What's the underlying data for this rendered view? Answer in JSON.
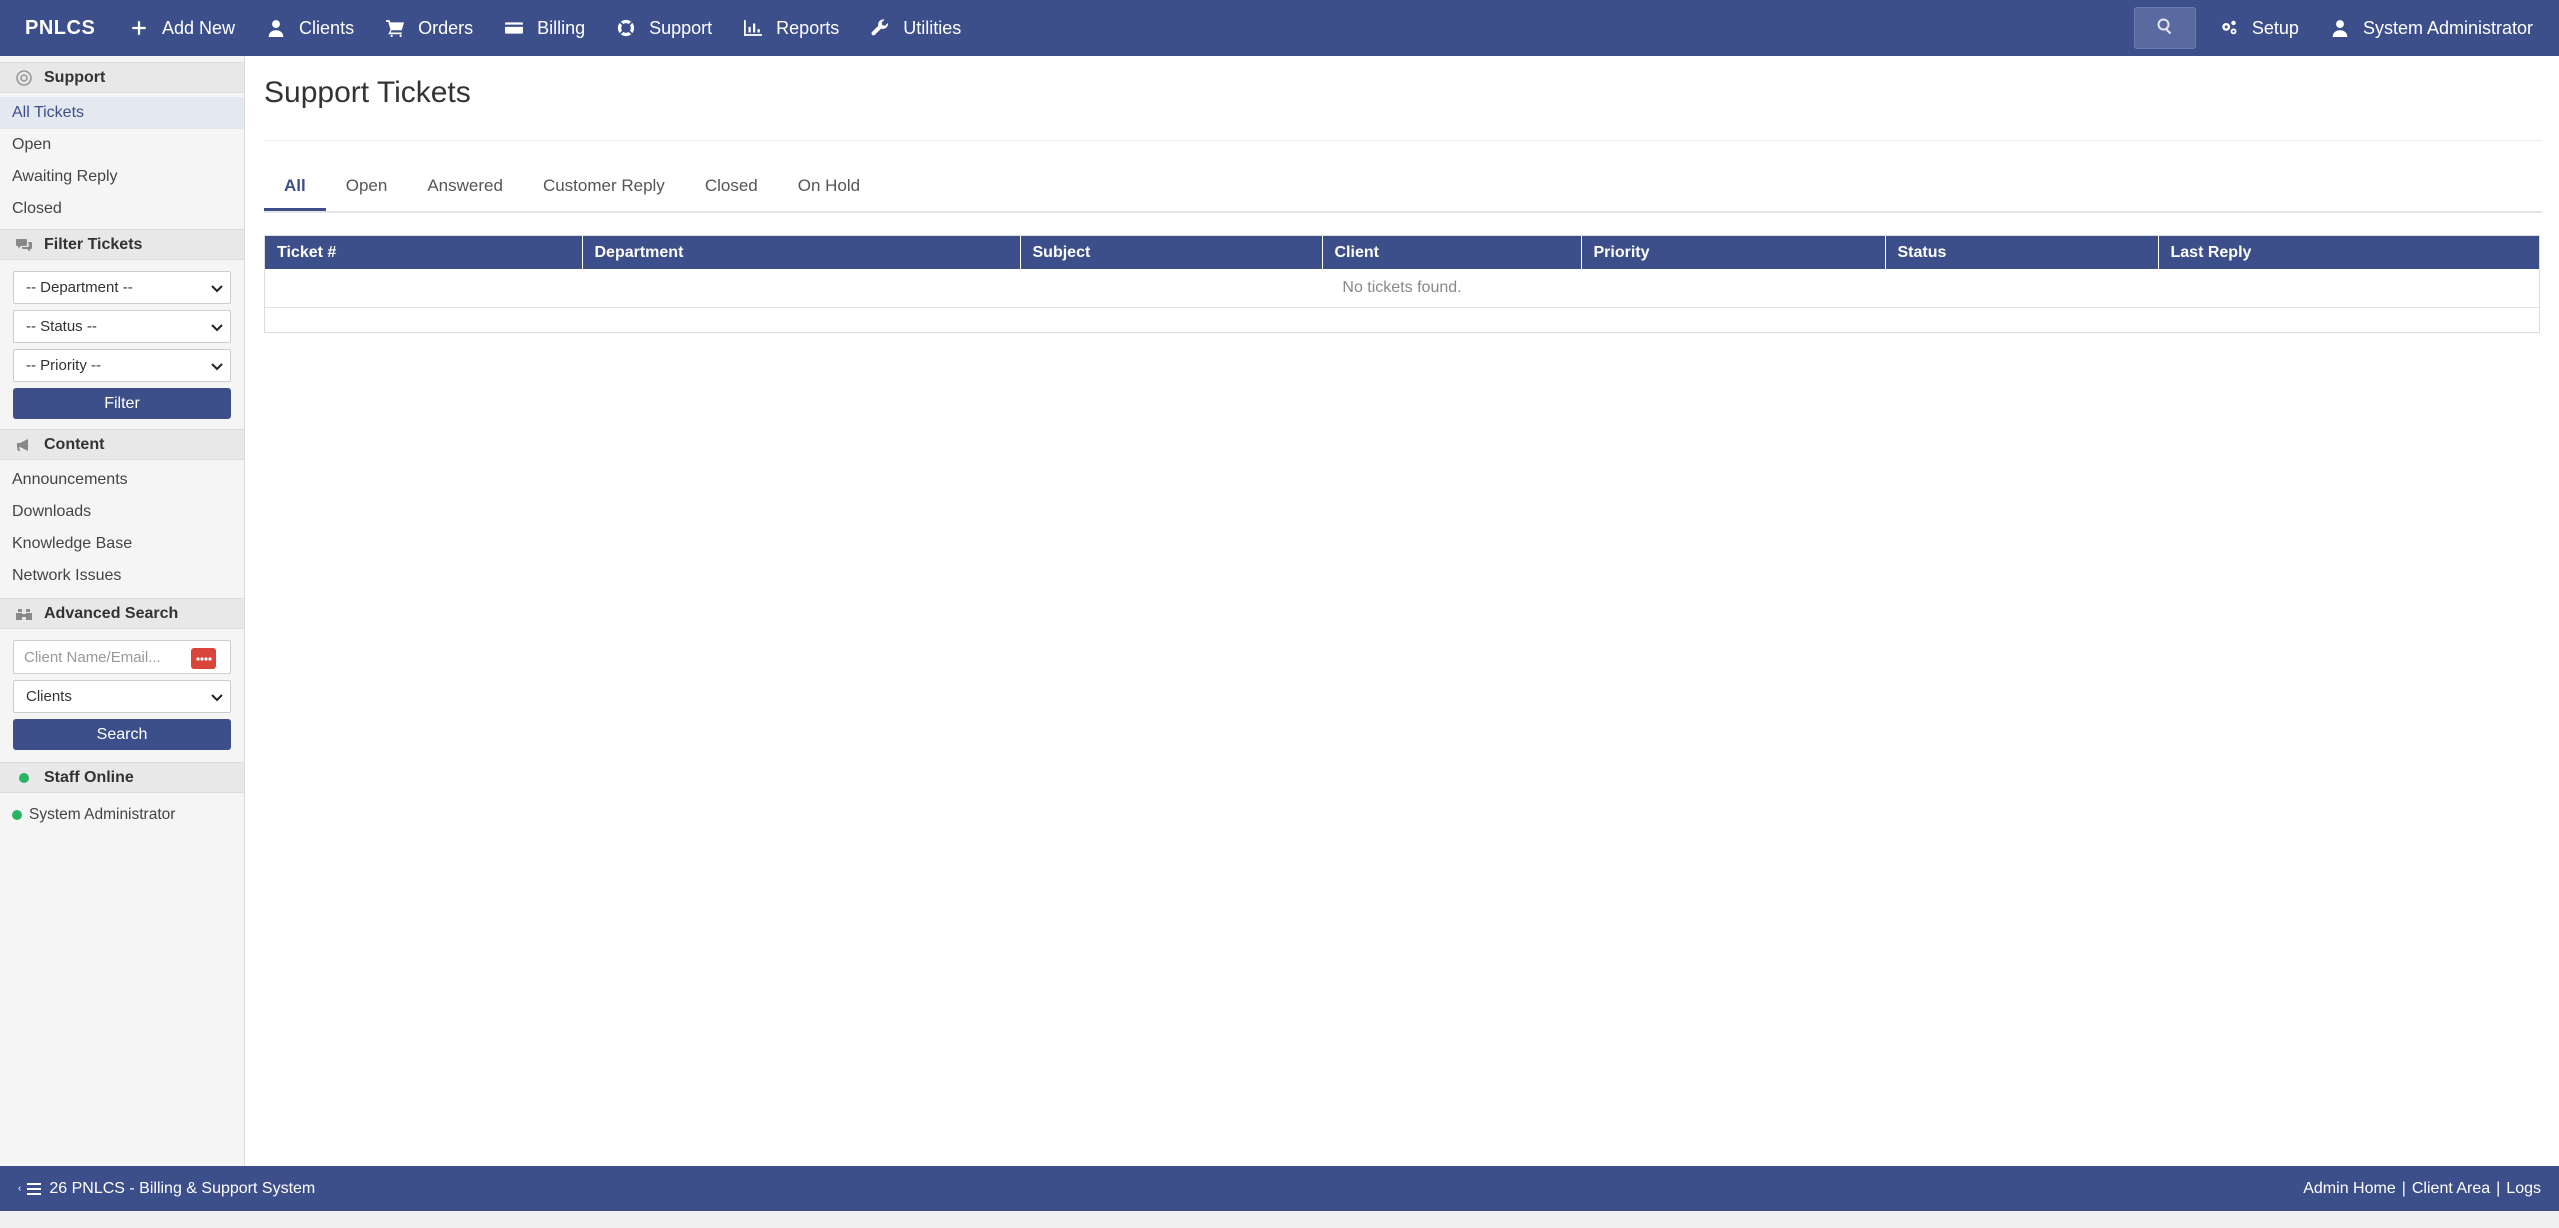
{
  "nav": {
    "brand": "PNLCS",
    "items": [
      {
        "label": "Add New",
        "icon": "plus-icon"
      },
      {
        "label": "Clients",
        "icon": "user-icon"
      },
      {
        "label": "Orders",
        "icon": "cart-icon"
      },
      {
        "label": "Billing",
        "icon": "credit-card-icon"
      },
      {
        "label": "Support",
        "icon": "lifebuoy-icon"
      },
      {
        "label": "Reports",
        "icon": "chart-icon"
      },
      {
        "label": "Utilities",
        "icon": "wrench-icon"
      }
    ],
    "setup_label": "Setup",
    "user_label": "System Administrator"
  },
  "sidebar": {
    "support": {
      "heading": "Support",
      "links": [
        "All Tickets",
        "Open",
        "Awaiting Reply",
        "Closed"
      ]
    },
    "filter": {
      "heading": "Filter Tickets",
      "department": "-- Department --",
      "status": "-- Status --",
      "priority": "-- Priority --",
      "button": "Filter"
    },
    "content": {
      "heading": "Content",
      "links": [
        "Announcements",
        "Downloads",
        "Knowledge Base",
        "Network Issues"
      ]
    },
    "advanced": {
      "heading": "Advanced Search",
      "placeholder": "Client Name/Email...",
      "select": "Clients",
      "button": "Search"
    },
    "staff": {
      "heading": "Staff Online",
      "users": [
        "System Administrator"
      ]
    }
  },
  "main": {
    "title": "Support Tickets",
    "tabs": [
      "All",
      "Open",
      "Answered",
      "Customer Reply",
      "Closed",
      "On Hold"
    ],
    "columns": [
      "Ticket #",
      "Department",
      "Subject",
      "Client",
      "Priority",
      "Status",
      "Last Reply"
    ],
    "empty": "No tickets found."
  },
  "footer": {
    "title": "26 PNLCS - Billing & Support System",
    "links": [
      "Admin Home",
      "Client Area",
      "Logs"
    ]
  },
  "colors": {
    "brand": "#3d4f8a",
    "danger": "#d9453a",
    "online": "#28b463"
  }
}
